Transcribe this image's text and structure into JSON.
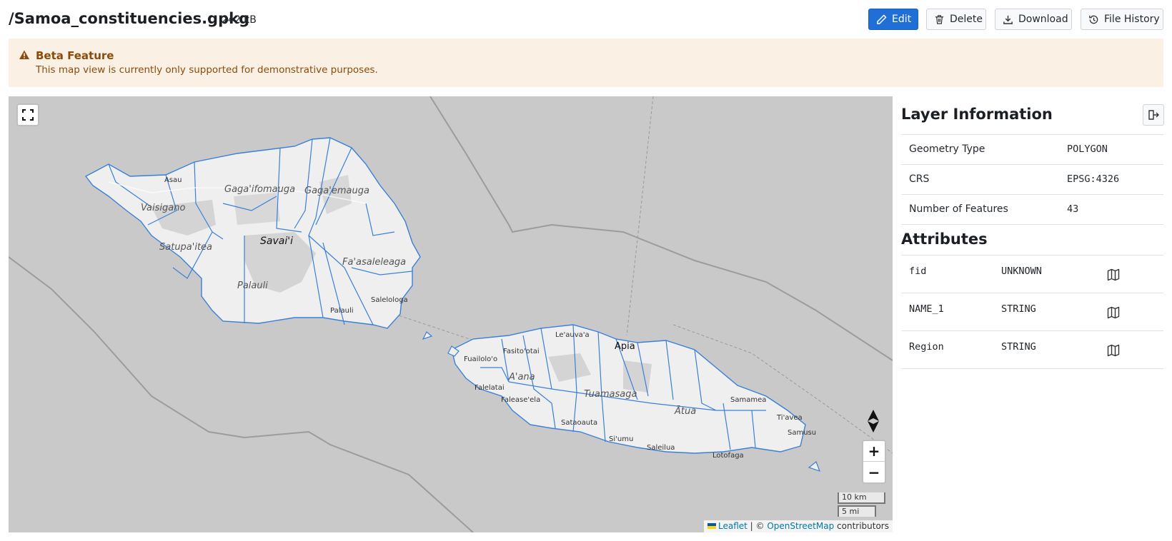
{
  "header": {
    "file_name": "/Samoa_constituencies.gpkg",
    "file_size": "242 kB",
    "buttons": {
      "edit": "Edit",
      "delete": "Delete",
      "download": "Download",
      "history": "File History"
    }
  },
  "banner": {
    "title": "Beta Feature",
    "text": "This map view is currently only supported for demonstrative purposes."
  },
  "map": {
    "labels": {
      "savaii": "Savai'i",
      "asau": "Asau",
      "vaisigano": "Vaisigano",
      "gagaifomauga": "Gaga'ifomauga",
      "gagaemauga": "Gaga'emauga",
      "satupaitea": "Satupa'itea",
      "faasaleleaga": "Fa'asaleleaga",
      "palauli_region": "Palauli",
      "palauli_town": "Palauli",
      "salelologa": "Salelologa",
      "apia": "Apia",
      "leauvaa": "Le'auva'a",
      "fasitootai": "Fasito'otai",
      "fuailoloo": "Fuailolo'o",
      "aana": "A'ana",
      "falelatai": "Falelatai",
      "faleaseela": "Falease'ela",
      "tuamasaga": "Tuamasaga",
      "atua": "Ātua",
      "samamea": "Samamea",
      "travea": "Ti'avea",
      "samusu": "Samusu",
      "sataoauta": "Sataoauta",
      "siumu": "Si'umu",
      "salelua": "Saleilua",
      "lotofaga": "Lotofaga"
    },
    "zoom_in": "+",
    "zoom_out": "−",
    "scale_km": "10 km",
    "scale_mi": "5 mi",
    "attribution": {
      "leaflet": "Leaflet",
      "separator": " | © ",
      "osm": "OpenStreetMap",
      "suffix": " contributors"
    },
    "colors": {
      "sea": "#c9c9c9",
      "land": "#efefef",
      "boundary": "#3a7fd9"
    }
  },
  "layer_info": {
    "title": "Layer Information",
    "rows": [
      {
        "key": "Geometry Type",
        "value": "POLYGON"
      },
      {
        "key": "CRS",
        "value": "EPSG:4326"
      },
      {
        "key": "Number of Features",
        "value": "43"
      }
    ]
  },
  "attributes": {
    "title": "Attributes",
    "rows": [
      {
        "name": "fid",
        "type": "UNKNOWN"
      },
      {
        "name": "NAME_1",
        "type": "STRING"
      },
      {
        "name": "Region",
        "type": "STRING"
      }
    ]
  }
}
